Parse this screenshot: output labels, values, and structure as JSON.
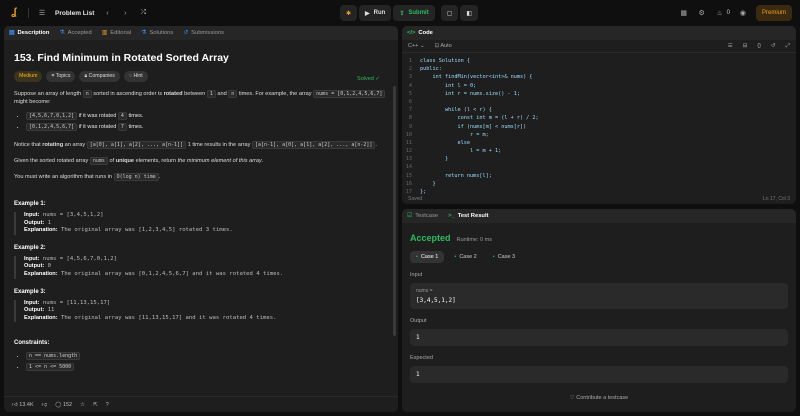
{
  "topbar": {
    "title": "Problem List",
    "run_label": "Run",
    "submit_label": "Submit",
    "streak_count": "0",
    "premium_label": "Premium"
  },
  "left_tabs": [
    {
      "label": "Description",
      "active": true
    },
    {
      "label": "Accepted",
      "active": false
    },
    {
      "label": "Editorial",
      "active": false
    },
    {
      "label": "Solutions",
      "active": false
    },
    {
      "label": "Submissions",
      "active": false
    }
  ],
  "problem": {
    "title": "153. Find Minimum in Rotated Sorted Array",
    "status": "Solved",
    "difficulty": "Medium",
    "chip_topics": "Topics",
    "chip_companies": "Companies",
    "chip_hint": "Hint",
    "p1_a": "Suppose an array of length ",
    "p1_n": "n",
    "p1_b": " sorted in ascending order is ",
    "p1_bold": "rotated",
    "p1_c": " between ",
    "p1_1": "1",
    "p1_d": " and ",
    "p1_n2": "n",
    "p1_e": " times. For example, the array ",
    "p1_nums": "nums = [0,1,2,4,5,6,7]",
    "p1_f": " might become:",
    "b1_code": "[4,5,6,7,0,1,2]",
    "b1_text": " if it was rotated ",
    "b1_k": "4",
    "b1_end": " times.",
    "b2_code": "[0,1,2,4,5,6,7]",
    "b2_text": " if it was rotated ",
    "b2_k": "7",
    "b2_end": " times.",
    "p2_a": "Notice that ",
    "p2_bold": "rotating",
    "p2_b": " an array ",
    "p2_c1": "[a[0], a[1], a[2], ..., a[n-1]]",
    "p2_c": " 1 time results in the array ",
    "p2_c2": "[a[n-1], a[0], a[1], a[2], ..., a[n-2]]",
    "p2_d": ".",
    "p3_a": "Given the sorted rotated array ",
    "p3_nums": "nums",
    "p3_b": " of ",
    "p3_bold": "unique",
    "p3_c": " elements, return ",
    "p3_em": "the minimum element of this array",
    "p3_d": ".",
    "p4_a": "You must write an algorithm that runs in ",
    "p4_code": "O(log n) time",
    "p4_b": "."
  },
  "examples": [
    {
      "heading": "Example 1:",
      "input": "nums = [3,4,5,1,2]",
      "output": "1",
      "explanation": "The original array was [1,2,3,4,5] rotated 3 times."
    },
    {
      "heading": "Example 2:",
      "input": "nums = [4,5,6,7,0,1,2]",
      "output": "0",
      "explanation": "The original array was [0,1,2,4,5,6,7] and it was rotated 4 times."
    },
    {
      "heading": "Example 3:",
      "input": "nums = [11,13,15,17]",
      "output": "11",
      "explanation": "The original array was [11,13,15,17] and it was rotated 4 times."
    }
  ],
  "labels": {
    "input": "Input:",
    "output": "Output:",
    "explanation": "Explanation:"
  },
  "constraints": {
    "heading": "Constraints:",
    "items": [
      "n == nums.length",
      "1 <= n <= 5000"
    ]
  },
  "footer": {
    "likes": "13.4K",
    "comments": "152"
  },
  "code": {
    "tab_label": "Code",
    "language": "C++",
    "auto_label": "Auto",
    "lines": [
      "class Solution {",
      "public:",
      "    int findMin(vector<int>& nums) {",
      "        int l = 0;",
      "        int r = nums.size() - 1;",
      "",
      "        while (l < r) {",
      "            const int m = (l + r) / 2;",
      "            if (nums[m] < nums[r])",
      "                r = m;",
      "            else",
      "                l = m + 1;",
      "        }",
      "",
      "        return nums[l];",
      "    }",
      "};"
    ],
    "saved": "Saved",
    "cursor": "Ln 17, Col 3"
  },
  "result": {
    "tab_testcase": "Testcase",
    "tab_result": "Test Result",
    "status": "Accepted",
    "runtime": "Runtime: 0 ms",
    "cases": [
      "Case 1",
      "Case 2",
      "Case 3"
    ],
    "input_label": "Input",
    "input_var": "nums =",
    "input_value": "[3,4,5,1,2]",
    "output_label": "Output",
    "output_value": "1",
    "expected_label": "Expected",
    "expected_value": "1",
    "contribute": "Contribute a testcase"
  }
}
